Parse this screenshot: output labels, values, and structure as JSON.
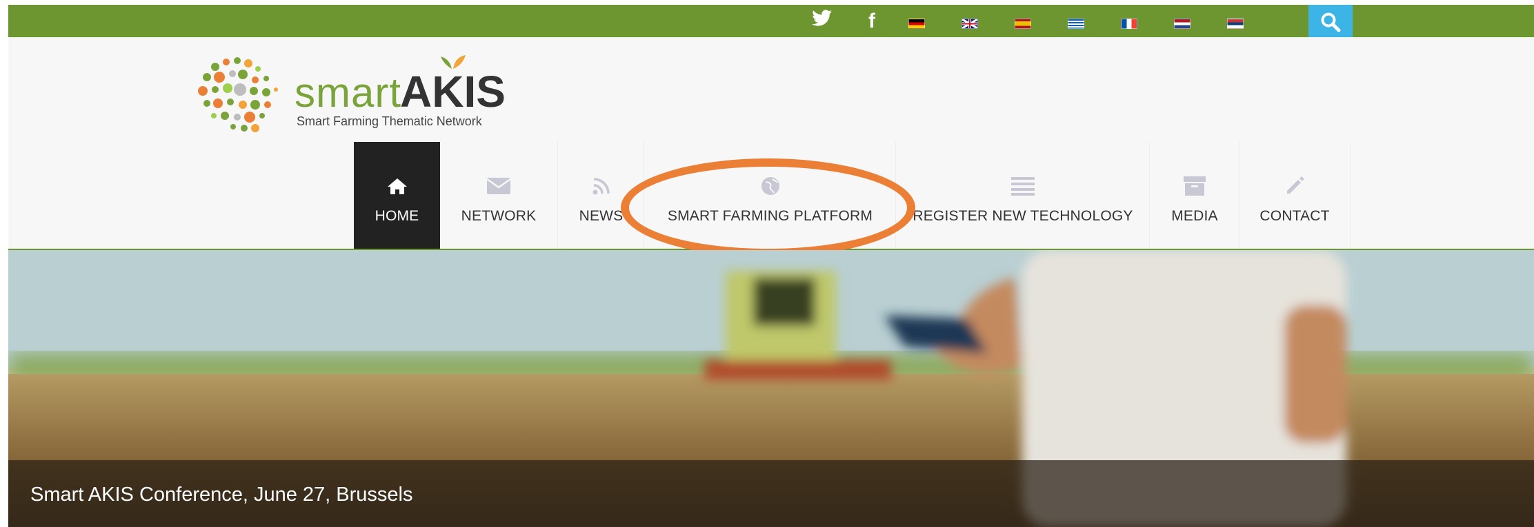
{
  "topbar": {
    "social": [
      {
        "icon": "twitter-icon",
        "glyph": "🐦"
      },
      {
        "icon": "facebook-icon",
        "glyph": "f"
      }
    ],
    "flags": [
      {
        "name": "german",
        "colors": [
          "#000000",
          "#dd0000",
          "#ffce00"
        ]
      },
      {
        "name": "english",
        "colors": [
          "#012169",
          "#ffffff",
          "#c8102e"
        ]
      },
      {
        "name": "spanish",
        "colors": [
          "#aa151b",
          "#f1bf00",
          "#aa151b"
        ]
      },
      {
        "name": "greek",
        "colors": [
          "#0d5eaf",
          "#ffffff",
          "#0d5eaf"
        ]
      },
      {
        "name": "french",
        "colors": [
          "#0055a4",
          "#ffffff",
          "#ef4135"
        ]
      },
      {
        "name": "dutch",
        "colors": [
          "#ae1c28",
          "#ffffff",
          "#21468b"
        ]
      },
      {
        "name": "serbian",
        "colors": [
          "#c6363c",
          "#0c4076",
          "#ffffff"
        ]
      }
    ],
    "search_icon": "search-icon"
  },
  "logo": {
    "word_light": "smart",
    "word_bold": "AKIS",
    "tagline": "Smart Farming Thematic Network"
  },
  "nav": {
    "items": [
      {
        "id": "home",
        "label": "HOME",
        "icon": "home-icon"
      },
      {
        "id": "network",
        "label": "NETWORK",
        "icon": "envelope-icon"
      },
      {
        "id": "news",
        "label": "NEWS",
        "icon": "rss-icon"
      },
      {
        "id": "smart-farming-platform",
        "label": "SMART FARMING PLATFORM",
        "icon": "globe-icon"
      },
      {
        "id": "register-new-technology",
        "label": "REGISTER NEW TECHNOLOGY",
        "icon": "list-icon"
      },
      {
        "id": "media",
        "label": "MEDIA",
        "icon": "archive-icon"
      },
      {
        "id": "contact",
        "label": "CONTACT",
        "icon": "pencil-icon"
      }
    ]
  },
  "hero": {
    "caption": "Smart AKIS Conference, June 27, Brussels"
  },
  "colors": {
    "topbar": "#6e9630",
    "search": "#3cb4e6",
    "highlight_ring": "#ec7f36",
    "nav_active": "#222222"
  }
}
